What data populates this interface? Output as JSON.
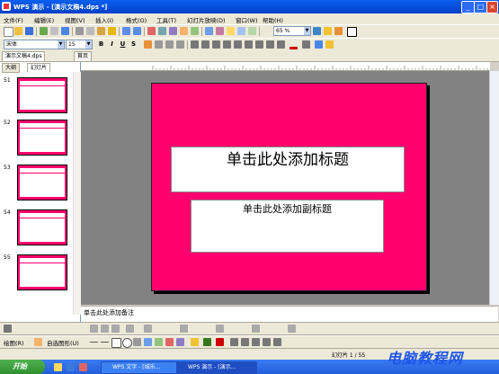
{
  "window": {
    "title": "WPS 演示 - [演示文稿4.dps *]",
    "minimize": "_",
    "maximize": "□",
    "close": "×"
  },
  "menu": [
    "文件(F)",
    "编辑(E)",
    "视图(V)",
    "插入(I)",
    "格式(O)",
    "工具(T)",
    "幻灯片放映(D)",
    "窗口(W)",
    "帮助(H)"
  ],
  "toolbar": {
    "zoom": "65 %",
    "font_name": "宋体",
    "font_size": "15",
    "bold": "B",
    "italic": "I",
    "underline": "U",
    "shadow": "S"
  },
  "doc_tabs": [
    "演示文稿4.dps",
    "首页"
  ],
  "left_panel": {
    "tabs": [
      "大纲",
      "幻灯片"
    ],
    "slides": [
      "51",
      "52",
      "53",
      "54",
      "55"
    ]
  },
  "slide": {
    "background_color": "#ff006e",
    "title_placeholder": "单击此处添加标题",
    "subtitle_placeholder": "单击此处添加副标题"
  },
  "notes": {
    "placeholder": "单击此处添加备注"
  },
  "draw_toolbar": {
    "draw_label": "绘图(R)",
    "autoshapes_label": "自选图形(U)"
  },
  "statusbar": {
    "slide_info": "幻灯片 1 / 55"
  },
  "taskbar": {
    "start": "开始",
    "tasks": [
      "WPS 文字 - [城乐...",
      "WPS 演示 - [演示..."
    ]
  },
  "brand": "电脑教程网"
}
